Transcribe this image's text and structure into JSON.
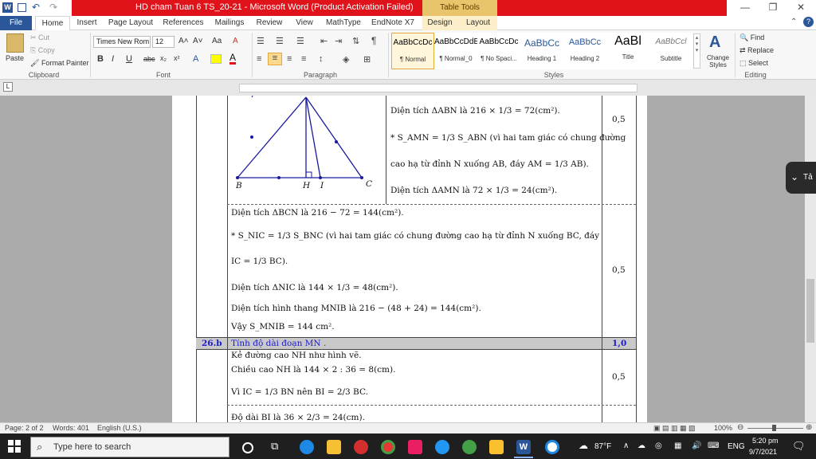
{
  "window": {
    "title": "HD cham Tuan 6 TS_20-21 - Microsoft Word (Product Activation Failed)",
    "table_tools": "Table Tools",
    "minimize": "—",
    "restore": "❐",
    "close": "✕"
  },
  "tabs": [
    "File",
    "Home",
    "Insert",
    "Page Layout",
    "References",
    "Mailings",
    "Review",
    "View",
    "MathType",
    "EndNote X7",
    "Design",
    "Layout"
  ],
  "clipboard": {
    "paste": "Paste",
    "cut": "Cut",
    "copy": "Copy",
    "format_painter": "Format Painter",
    "label": "Clipboard"
  },
  "font": {
    "name": "Times New Rom",
    "size": "12",
    "label": "Font",
    "bold": "B",
    "italic": "I",
    "underline": "U",
    "strike": "abc",
    "sub": "x₂",
    "sup": "x²",
    "grow": "A˄",
    "shrink": "A˅",
    "case": "Aa",
    "clear": "A"
  },
  "paragraph": {
    "label": "Paragraph",
    "pilcrow": "¶"
  },
  "styles": {
    "label": "Styles",
    "items": [
      {
        "sample": "AaBbCcDc",
        "name": "¶ Normal"
      },
      {
        "sample": "AaBbCcDdE",
        "name": "¶ Normal_0"
      },
      {
        "sample": "AaBbCcDc",
        "name": "¶ No Spaci..."
      },
      {
        "sample": "AaBbCc",
        "name": "Heading 1"
      },
      {
        "sample": "AaBbCc",
        "name": "Heading 2"
      },
      {
        "sample": "AaBl",
        "name": "Title"
      },
      {
        "sample": "AaBbCcl",
        "name": "Subtitle"
      }
    ],
    "change_styles": "Change Styles"
  },
  "editing": {
    "label": "Editing",
    "find": "Find",
    "replace": "Replace",
    "select": "Select"
  },
  "doc": {
    "fig_labels": [
      "B",
      "H",
      "I",
      "C"
    ],
    "r1": [
      "Diện tích ΔABN là 216 × 1/3 = 72(cm²).",
      "* S_AMN = 1/3 S_ABN (vì hai tam giác có chung đường",
      "cao hạ từ đỉnh N xuống AB, đáy AM = 1/3 AB).",
      "Diện tích ΔAMN là 72 × 1/3 = 24(cm²)."
    ],
    "score1": "0,5",
    "r2": [
      "Diện tích ΔBCN là 216 − 72 = 144(cm²).",
      "* S_NIC = 1/3 S_BNC (vì hai tam giác có chung đường cao hạ từ đỉnh N xuống BC, đáy",
      "IC = 1/3 BC).",
      "Diện tích ΔNIC là 144 × 1/3 = 48(cm²).",
      "Diện tích hình thang MNIB là 216 − (48 + 24) = 144(cm²).",
      "Vậy S_MNIB = 144 cm²."
    ],
    "score2": "0,5",
    "head_num": "26.b",
    "head_text": "Tính độ dài đoạn MN .",
    "head_score": "1,0",
    "r3": [
      "Kẻ đường cao NH như hình vẽ.",
      "Chiều cao NH là 144 × 2 : 36 = 8(cm).",
      "Vì IC = 1/3 BN nên BI = 2/3 BC.",
      "Độ dài BI là 36 × 2/3 = 24(cm)."
    ],
    "score3": "0,5"
  },
  "status": {
    "page": "Page: 2 of 2",
    "words": "Words: 401",
    "lang": "English (U.S.)",
    "zoom": "100%"
  },
  "taskbar": {
    "search_placeholder": "Type here to search",
    "weather": "87°F",
    "lang": "ENG",
    "time": "5:20 pm",
    "date": "9/7/2021"
  },
  "popup": {
    "text": "Tả"
  }
}
